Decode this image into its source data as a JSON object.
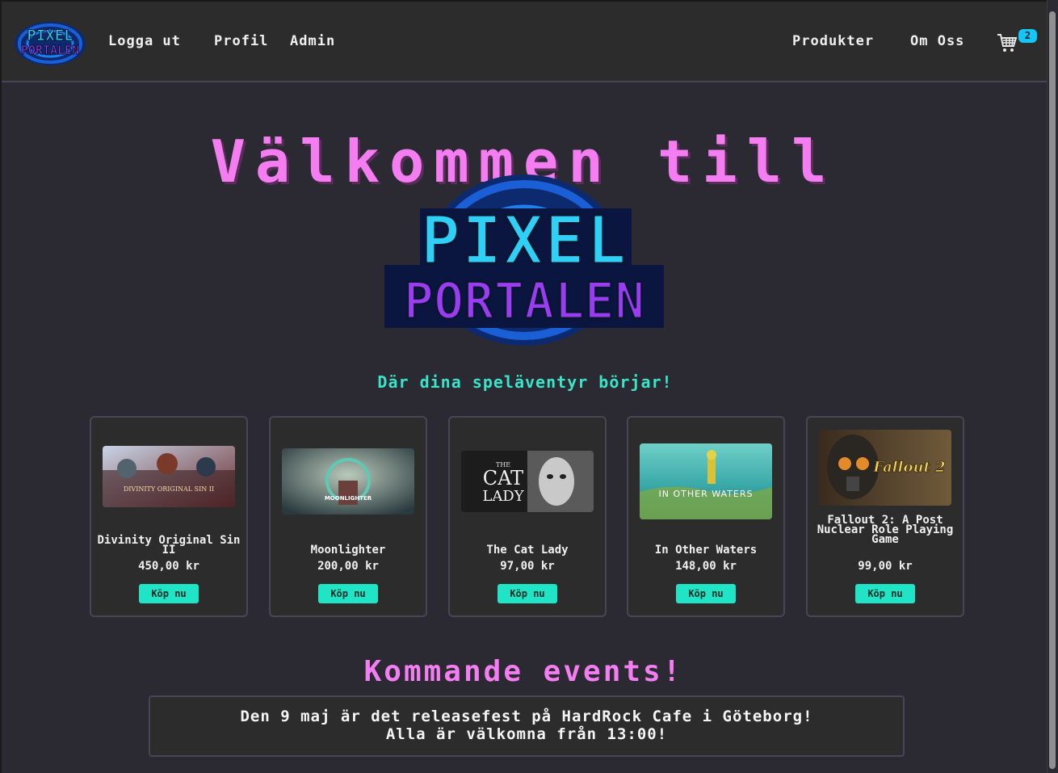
{
  "nav": {
    "logo_text_top": "PIXEL",
    "logo_text_bottom": "PORTALEN",
    "left_links": [
      "Logga ut",
      "Profil",
      "Admin"
    ],
    "right_links": [
      "Produkter",
      "Om Oss"
    ],
    "cart_icon": "shopping-cart-icon",
    "cart_count": "2"
  },
  "hero": {
    "title": "Välkommen till",
    "logo_text_top": "PIXEL",
    "logo_text_bottom": "PORTALEN",
    "tagline": "Där dina speläventyr börjar!"
  },
  "products": [
    {
      "title": "Divinity Original Sin II",
      "price": "450,00 kr",
      "button": "Köp nu",
      "image_text": "DIVINITY ORIGINAL SIN II"
    },
    {
      "title": "Moonlighter",
      "price": "200,00 kr",
      "button": "Köp nu",
      "image_text": "MOONLIGHTER"
    },
    {
      "title": "The Cat Lady",
      "price": "97,00 kr",
      "button": "Köp nu",
      "image_text_small": "THE",
      "image_text_line1": "CAT",
      "image_text_line2": "LADY"
    },
    {
      "title": "In Other Waters",
      "price": "148,00 kr",
      "button": "Köp nu",
      "image_text": "IN OTHER WATERS"
    },
    {
      "title": "Fallout 2: A Post Nuclear Role Playing Game",
      "price": "99,00 kr",
      "button": "Köp nu",
      "image_text": "Fallout 2"
    }
  ],
  "events": {
    "title": "Kommande events!",
    "line1": "Den 9 maj är det releasefest på HardRock Cafe i Göteborg!",
    "line2": "Alla är välkomna från 13:00!"
  },
  "colors": {
    "background": "#2b2a33",
    "navbar": "#2c2c2c",
    "accent_pink": "#f47ef1",
    "accent_teal": "#1fe4c6",
    "badge_blue": "#13c6f5",
    "logo_cyan": "#2ed0f5",
    "logo_purple": "#9a3cf0"
  }
}
